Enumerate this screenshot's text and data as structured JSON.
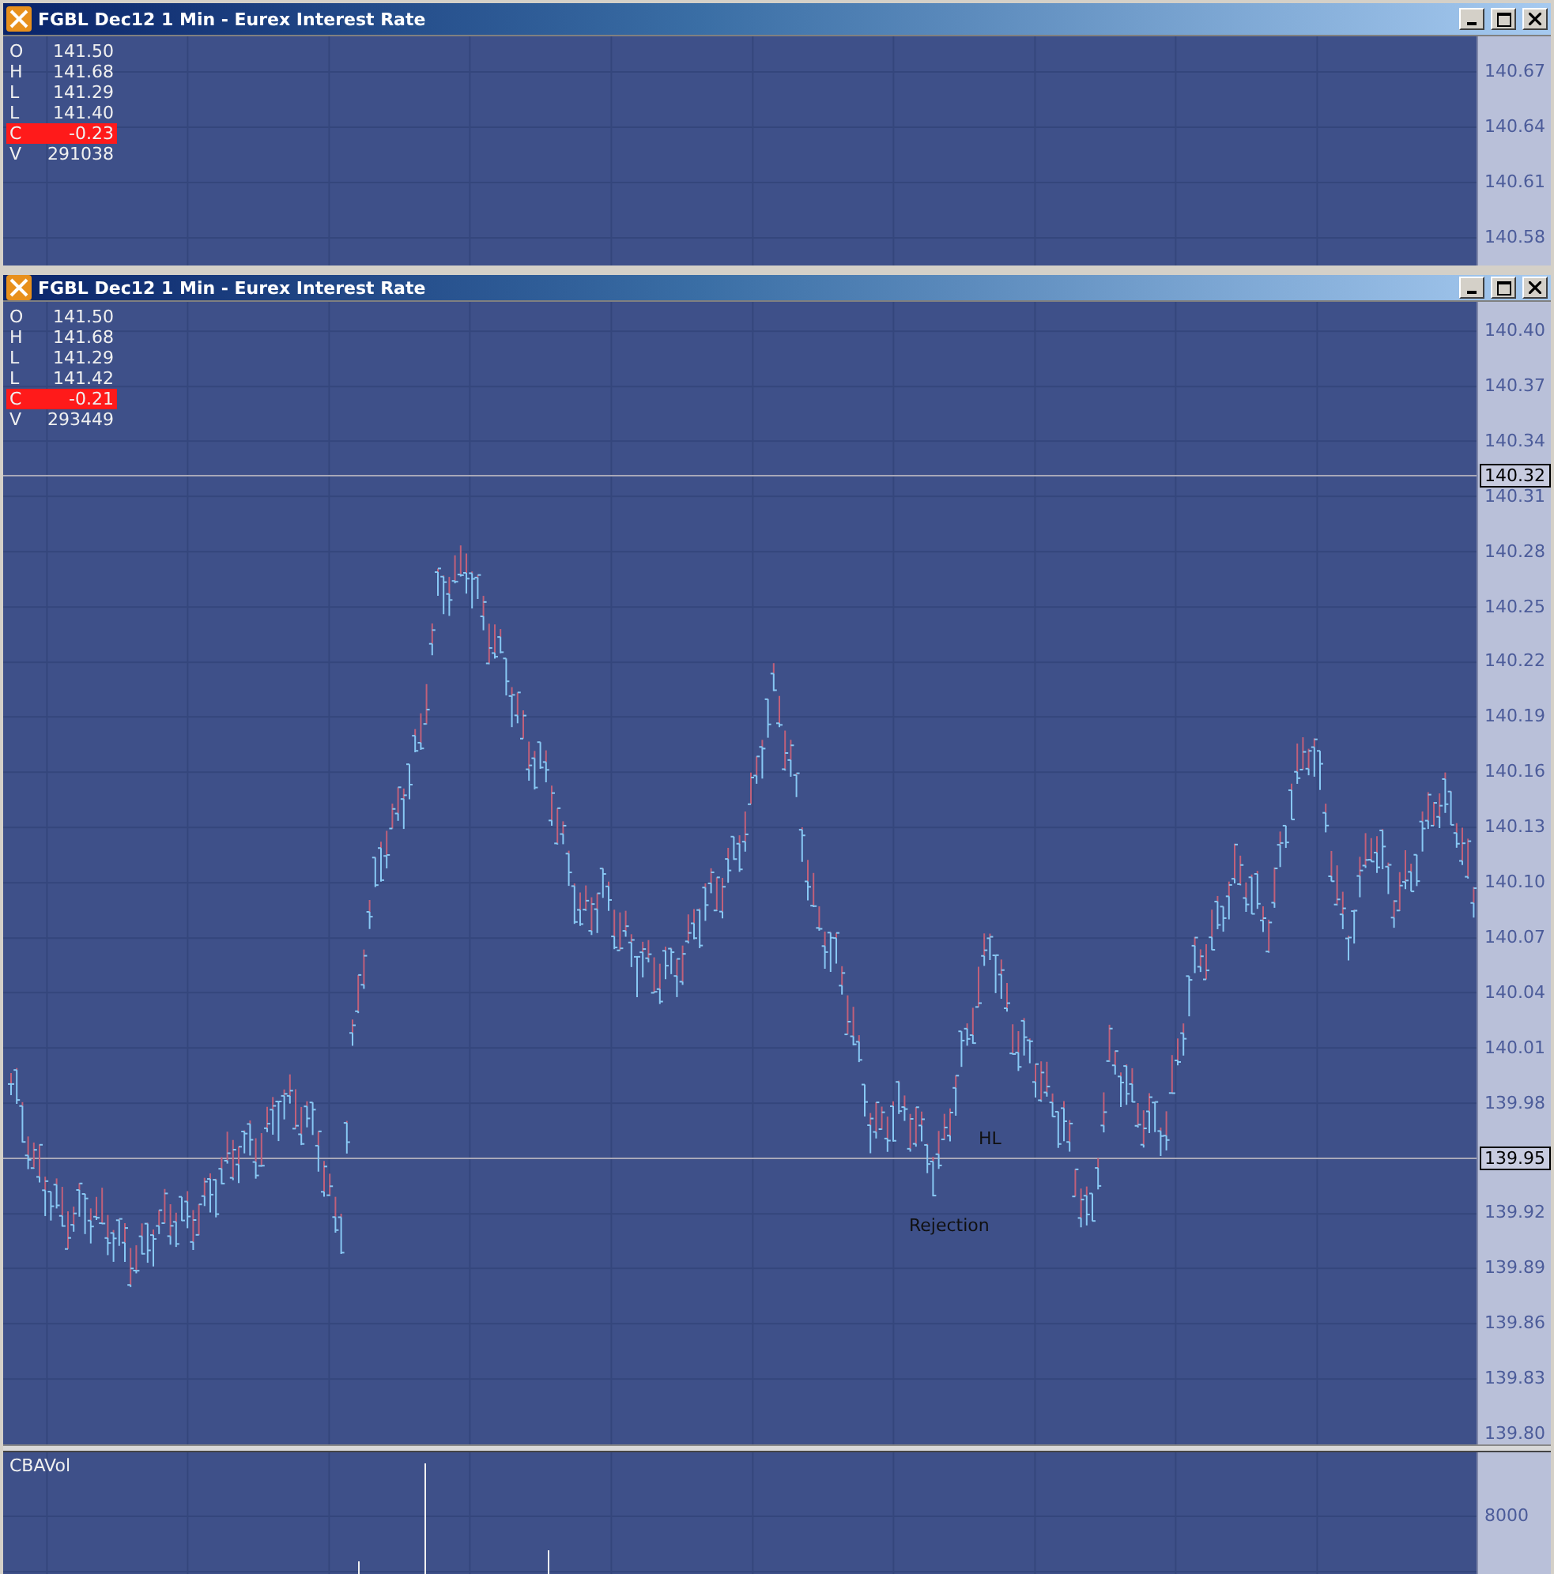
{
  "windows": [
    {
      "title": "FGBL Dec12 1 Min - Eurex Interest Rate",
      "legend": [
        {
          "label": "O",
          "value": "141.50",
          "highlight": false
        },
        {
          "label": "H",
          "value": "141.68",
          "highlight": false
        },
        {
          "label": "L",
          "value": "141.29",
          "highlight": false
        },
        {
          "label": "L",
          "value": "141.40",
          "highlight": false
        },
        {
          "label": "C",
          "value": "-0.23",
          "highlight": true
        },
        {
          "label": "V",
          "value": "291038",
          "highlight": false
        }
      ],
      "price_axis": [
        "140.67",
        "140.64",
        "140.61",
        "140.58"
      ]
    },
    {
      "title": "FGBL Dec12 1 Min - Eurex Interest Rate",
      "legend": [
        {
          "label": "O",
          "value": "141.50",
          "highlight": false
        },
        {
          "label": "H",
          "value": "141.68",
          "highlight": false
        },
        {
          "label": "L",
          "value": "141.29",
          "highlight": false
        },
        {
          "label": "L",
          "value": "141.42",
          "highlight": false
        },
        {
          "label": "C",
          "value": "-0.21",
          "highlight": true
        },
        {
          "label": "V",
          "value": "293449",
          "highlight": false
        }
      ],
      "price_axis": [
        "140.40",
        "140.37",
        "140.34",
        "140.31",
        "140.28",
        "140.25",
        "140.22",
        "140.19",
        "140.16",
        "140.13",
        "140.10",
        "140.07",
        "140.04",
        "140.01",
        "139.98",
        "139.92",
        "139.89",
        "139.86",
        "139.83",
        "139.80"
      ],
      "markers": [
        {
          "label": "140.32"
        },
        {
          "label": "139.95"
        }
      ],
      "annotations": [
        {
          "text": "HL"
        },
        {
          "text": "Rejection"
        }
      ],
      "indicator": {
        "title": "CBAVol",
        "axis": [
          "8000"
        ]
      }
    }
  ]
}
